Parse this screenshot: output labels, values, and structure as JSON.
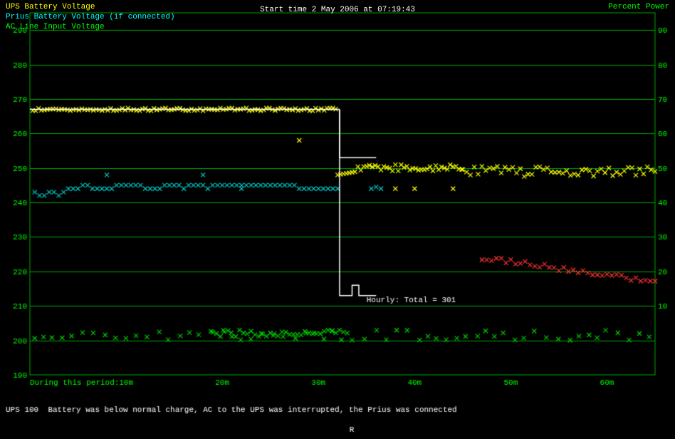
{
  "header": {
    "title": "UPS Battery Voltage",
    "start_time": "Start time  2 May 2006 at 07:19:43",
    "percent_power": "Percent Power",
    "legend_prius": "Prius Battery Voltage (if connected)",
    "legend_ac": "AC Line Input Voltage"
  },
  "y_axis": {
    "left_labels": [
      "290",
      "280",
      "270",
      "260",
      "250",
      "240",
      "230",
      "220",
      "210",
      "200",
      "190"
    ],
    "right_labels": [
      "90",
      "80",
      "70",
      "60",
      "50",
      "40",
      "30",
      "20",
      "10"
    ]
  },
  "x_axis": {
    "labels": [
      "10m",
      "20m",
      "30m",
      "40m",
      "50m",
      "60m"
    ]
  },
  "annotations": {
    "hourly": "Hourly: Total = 301",
    "bottom_note": "During this period:",
    "note_detail": "UPS 100  Battery was below normal charge, AC to the UPS was interrupted, the Prius was connected"
  },
  "colors": {
    "background": "#000000",
    "grid": "#008000",
    "ups_voltage": "#ffff00",
    "prius_voltage": "#00ffff",
    "red_data": "#ff0000",
    "white_line": "#ffffff",
    "text_primary": "#00ff00",
    "text_white": "#ffffff"
  }
}
